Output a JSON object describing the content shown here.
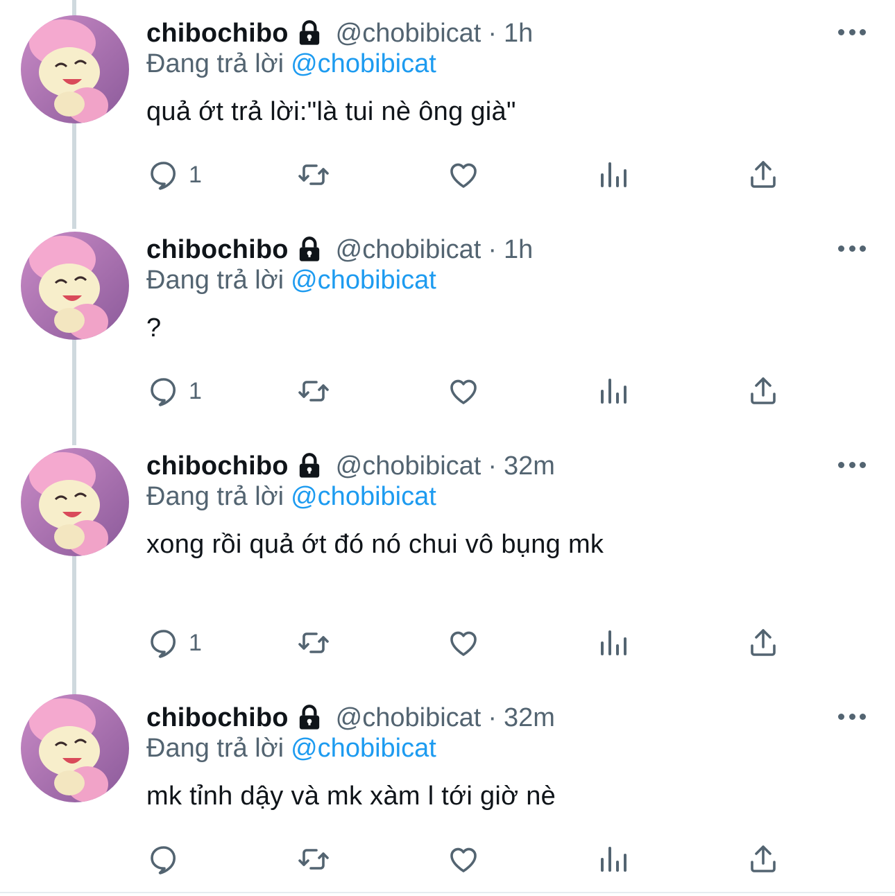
{
  "tweets": [
    {
      "display_name": "chibochibo",
      "handle": "@chobibicat",
      "separator": "·",
      "time": "1h",
      "replying_prefix": "Đang trả lời",
      "replying_to": "@chobibicat",
      "text": "quả ớt trả lời:\"là tui nè ông già\"",
      "reply_count": "1"
    },
    {
      "display_name": "chibochibo",
      "handle": "@chobibicat",
      "separator": "·",
      "time": "1h",
      "replying_prefix": "Đang trả lời",
      "replying_to": "@chobibicat",
      "text": "?",
      "reply_count": "1"
    },
    {
      "display_name": "chibochibo",
      "handle": "@chobibicat",
      "separator": "·",
      "time": "32m",
      "replying_prefix": "Đang trả lời",
      "replying_to": "@chobibicat",
      "text": "xong rồi quả ớt đó nó chui vô bụng mk",
      "reply_count": "1"
    },
    {
      "display_name": "chibochibo",
      "handle": "@chobibicat",
      "separator": "·",
      "time": "32m",
      "replying_prefix": "Đang trả lời",
      "replying_to": "@chobibicat",
      "text": "mk tỉnh dậy và mk xàm l tới giờ nè",
      "reply_count": ""
    }
  ],
  "icons": {
    "reply": "reply-icon",
    "retweet": "retweet-icon",
    "like": "like-icon",
    "views": "analytics-icon",
    "share": "share-icon",
    "lock": "lock-icon",
    "more": "more-options-icon"
  },
  "colors": {
    "text": "#0f1419",
    "secondary": "#536471",
    "accent": "#1d9bf0",
    "thread_line": "#cfd9de"
  }
}
